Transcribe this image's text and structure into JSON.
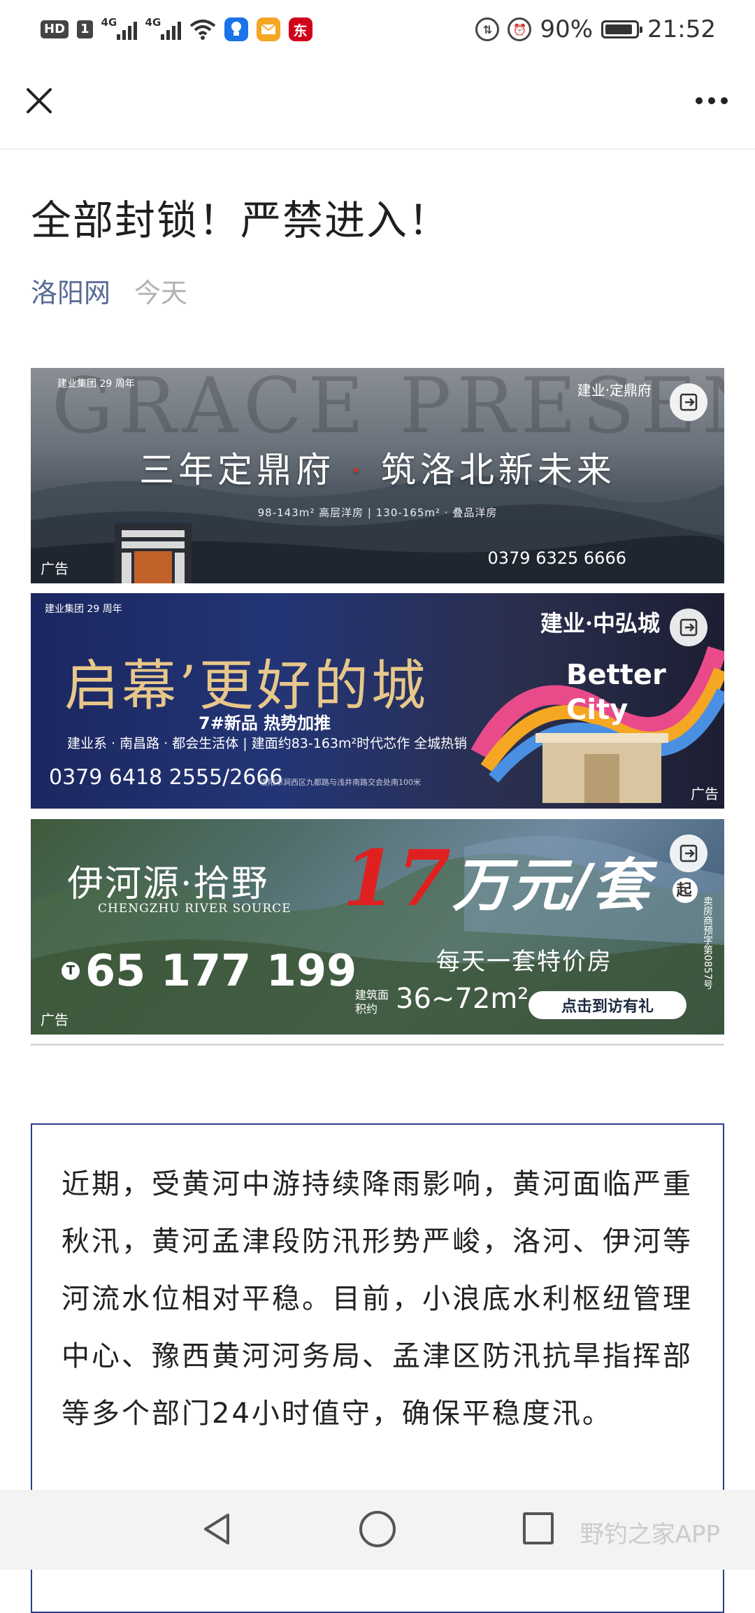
{
  "status_bar": {
    "hd": "HD",
    "sim": "1",
    "signal1": "4G",
    "signal2": "4G",
    "app3_label": "东",
    "battery_percent": "90%",
    "battery_level": 0.9,
    "time": "21:52"
  },
  "article": {
    "title": "全部封锁！严禁进入！",
    "account": "洛阳网",
    "date": "今天"
  },
  "ads": [
    {
      "bg_text": "GRACE PRESENT",
      "logo": "建业集团 29 周年",
      "brand": "建业·定鼎府",
      "headline_a": "三年定鼎府",
      "headline_dot": "·",
      "headline_b": "筑洛北新未来",
      "sub": "98-143m² 高层洋房 | 130-165m² · 叠品洋房",
      "phone": "0379 6325 6666",
      "tag": "广告"
    },
    {
      "logo": "建业集团 29 周年",
      "brand": "建业·中弘城",
      "title": "启幕’更好的城",
      "sub": "7#新品  热势加推",
      "line": "建业系 · 南昌路 · 都会生活体 | 建面约83-163m²时代芯作 全城热销",
      "phone": "0379 6418 2555/2666",
      "address": "洛阳市涧西区九都路与浅井南路交会处南100米",
      "better": "Better City",
      "tag": "广告"
    },
    {
      "title": "伊河源·拾野",
      "subtitle": "CHENGZHU RIVER SOURCE",
      "phone": "65 177 199",
      "price_num": "17",
      "price_rest": "万元/套",
      "price_suffix": "起",
      "daily": "每天一套特价房",
      "area_label": "建筑面积约",
      "area": "36~72m²",
      "cta": "点击到访有礼",
      "permit": "卖房商预字第0857号",
      "tag": "广告"
    }
  ],
  "body": {
    "paragraph": "近期，受黄河中游持续降雨影响，黄河面临严重秋汛，黄河孟津段防汛形势严峻，洛河、伊河等河流水位相对平稳。目前，小浪底水利枢纽管理中心、豫西黄河河务局、孟津区防汛抗旱指挥部等多个部门24小时值守，确保平稳度汛。"
  },
  "watermark": "野钓之家APP",
  "colors": {
    "account_link": "#576b95",
    "body_border": "#2c3e8a",
    "price_red": "#e02020"
  }
}
